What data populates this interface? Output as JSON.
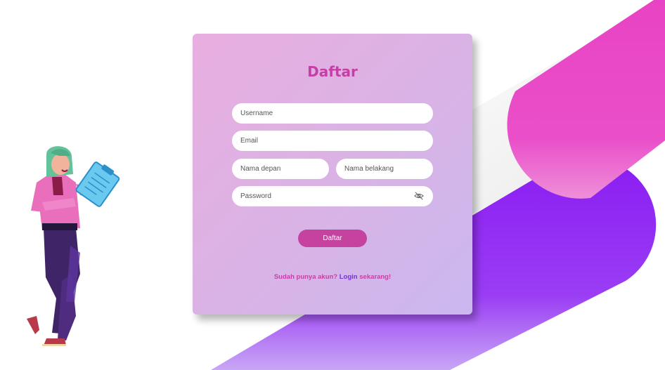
{
  "form": {
    "title": "Daftar",
    "username_placeholder": "Username",
    "email_placeholder": "Email",
    "first_name_placeholder": "Nama depan",
    "last_name_placeholder": "Nama belakang",
    "password_placeholder": "Password",
    "password_toggle_icon": "eye-off-icon",
    "submit_label": "Daftar",
    "footer_prefix": "Sudah punya akun?",
    "footer_link": "Login",
    "footer_suffix": "sekarang!"
  },
  "colors": {
    "accent": "#c540a6",
    "link": "#7432d8",
    "button": "#c5429f",
    "pink_shape": "#e843c4",
    "purple_shape": "#8a1cf2"
  }
}
